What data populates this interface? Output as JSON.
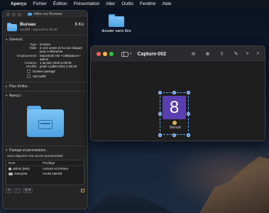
{
  "menubar": {
    "apple": "",
    "app": "Aperçu",
    "items": [
      "Fichier",
      "Édition",
      "Présentation",
      "Aller",
      "Outils",
      "Fenêtre",
      "Aide"
    ]
  },
  "desktop": {
    "folder_label": "dossier sans titre"
  },
  "info_window": {
    "title": "Infos sur Bureau",
    "name": "Bureau",
    "size": "6 Ko",
    "modified": "Modifié : aujourd'hui 08:49",
    "general": {
      "header": "Général :",
      "rows": [
        {
          "k": "Type :",
          "v": "Dossier"
        },
        {
          "k": "Taille :",
          "v": "6 144 octets (6 Ko sur disque)"
        },
        {
          "k": "",
          "v": "pour 2 éléments"
        },
        {
          "k": "Emplacement :",
          "v": "Macintosh HD • Utilisateurs •"
        },
        {
          "k": "",
          "v": "admin"
        },
        {
          "k": "Création :",
          "v": "1 janvier 2020 à 09:00"
        },
        {
          "k": "Modifié :",
          "v": "jeudi 1 juillet 2021 à 08:49"
        }
      ],
      "shared_folder": "Dossier partagé",
      "locked": "Verrouillé"
    },
    "more_info": "Plus d'infos :",
    "preview": "Aperçu :",
    "sharing": {
      "header": "Partage et permissions :",
      "text": "Vous disposez d'un accès personnalisé.",
      "col_name": "Nom",
      "col_priv": "Privilège",
      "rows": [
        {
          "name": "admin (Moi)",
          "priv": "Lecture et écriture"
        },
        {
          "name": "everyone",
          "priv": "Accès interdit"
        }
      ],
      "add": "+",
      "remove": "−",
      "action": "⊙ ▾"
    }
  },
  "preview_window": {
    "title": "Capture-002",
    "avatar_text": "8",
    "user_name": "Benoit",
    "colors": {
      "avatar": "#5a3fb0",
      "selection": "#3e86e5"
    }
  }
}
